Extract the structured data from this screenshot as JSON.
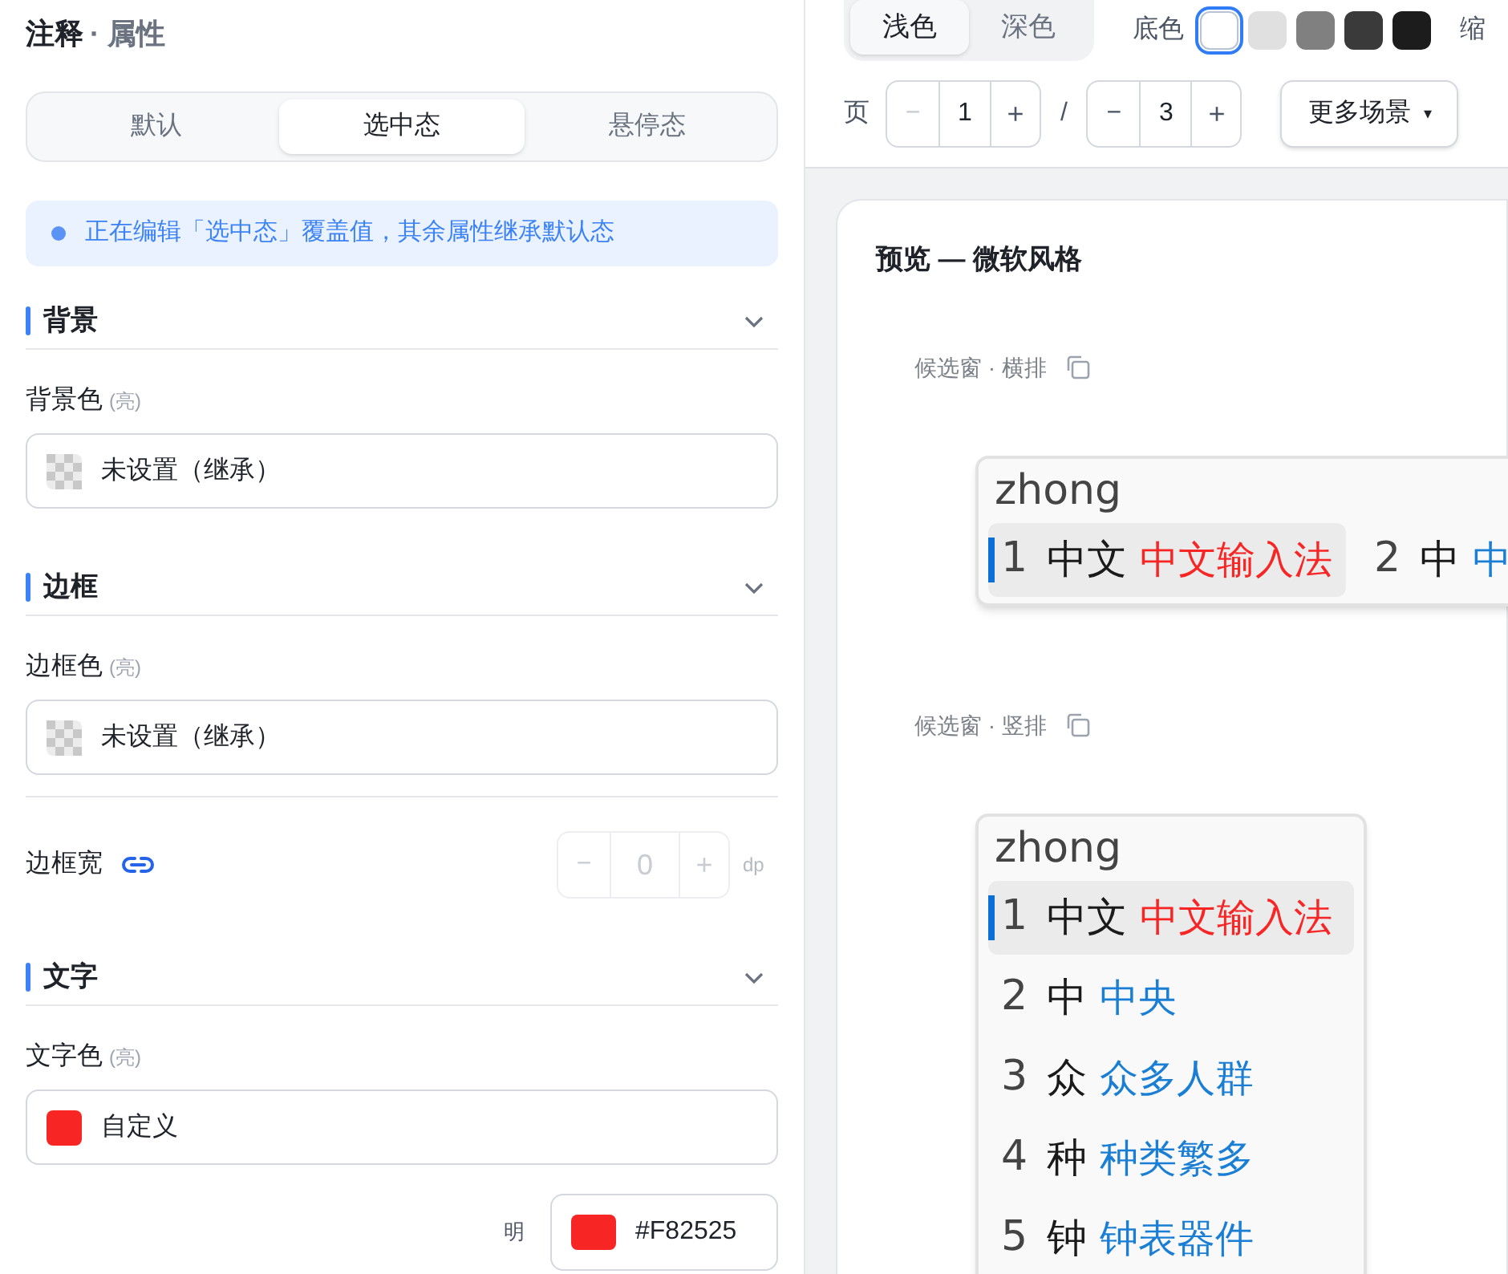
{
  "panel": {
    "title": "注释",
    "subtitle": "· 属性"
  },
  "state_tabs": [
    {
      "label": "默认",
      "selected": false
    },
    {
      "label": "选中态",
      "selected": true
    },
    {
      "label": "悬停态",
      "selected": false
    }
  ],
  "notice": "正在编辑「选中态」覆盖值，其余属性继承默认态",
  "sections": [
    {
      "title": "背景",
      "expanded": true,
      "fields": [
        {
          "kind": "color",
          "label": "背景色",
          "hint": "(亮)",
          "value": "未设置（继承）"
        }
      ]
    },
    {
      "title": "边框",
      "expanded": true,
      "fields": [
        {
          "kind": "color",
          "label": "边框色",
          "hint": "(亮)",
          "value": "未设置（继承）"
        },
        {
          "kind": "stepper",
          "label": "边框宽",
          "linked": true,
          "value": "0",
          "unit": "dp",
          "disabled": true,
          "minus": "−",
          "plus": "+"
        }
      ]
    },
    {
      "title": "文字",
      "expanded": true,
      "fields": [
        {
          "kind": "color",
          "label": "文字色",
          "hint": "(亮)",
          "value": "自定义",
          "color": "#F82525"
        },
        {
          "kind": "hex",
          "label": "明",
          "value": "#F82525",
          "color": "#F82525"
        }
      ]
    }
  ],
  "toolbar": {
    "themes": [
      {
        "label": "浅色",
        "selected": true
      },
      {
        "label": "深色",
        "selected": false
      }
    ],
    "base_label": "底色",
    "base_colors": [
      {
        "color": "#ffffff",
        "selected": true
      },
      {
        "color": "#e0e0e0",
        "selected": false
      },
      {
        "color": "#808080",
        "selected": false
      },
      {
        "color": "#3a3a3a",
        "selected": false
      },
      {
        "color": "#1c1c1c",
        "selected": false
      }
    ],
    "zoom_label": "缩",
    "page_label": "页",
    "page": {
      "minus": "−",
      "value": "1",
      "plus": "+",
      "minus_disabled": true
    },
    "separator": "/",
    "total": {
      "minus": "−",
      "value": "3",
      "plus": "+",
      "minus_disabled": false
    },
    "more": {
      "label": "更多场景",
      "caret": "▾"
    }
  },
  "preview": {
    "title": "预览 — 微软风格",
    "horizontal": {
      "label": "候选窗 · 横排",
      "preedit": "zhong",
      "candidates": [
        {
          "index": "1",
          "word": "中文",
          "comment": "中文输入法",
          "selected": true
        },
        {
          "index": "2",
          "word": "中",
          "comment": "中",
          "selected": false
        }
      ]
    },
    "vertical": {
      "label": "候选窗 · 竖排",
      "preedit": "zhong",
      "candidates": [
        {
          "index": "1",
          "word": "中文",
          "comment": "中文输入法",
          "selected": true
        },
        {
          "index": "2",
          "word": "中",
          "comment": "中央",
          "selected": false
        },
        {
          "index": "3",
          "word": "众",
          "comment": "众多人群",
          "selected": false
        },
        {
          "index": "4",
          "word": "种",
          "comment": "种类繁多",
          "selected": false
        },
        {
          "index": "5",
          "word": "钟",
          "comment": "钟表器件",
          "selected": false
        }
      ]
    }
  }
}
